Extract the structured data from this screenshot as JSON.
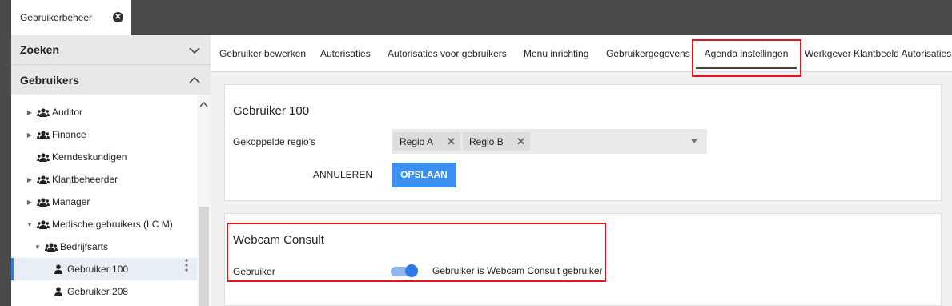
{
  "window": {
    "tab_title": "Gebruikerbeheer"
  },
  "sidebar": {
    "sections": [
      {
        "label": "Zoeken",
        "state": "collapsed"
      },
      {
        "label": "Gebruikers",
        "state": "expanded"
      }
    ],
    "tree": [
      {
        "label": "Auditor",
        "type": "group",
        "expandable": true
      },
      {
        "label": "Finance",
        "type": "group",
        "expandable": true
      },
      {
        "label": "Kerndeskundigen",
        "type": "group",
        "expandable": false
      },
      {
        "label": "Klantbeheerder",
        "type": "group",
        "expandable": true
      },
      {
        "label": "Manager",
        "type": "group",
        "expandable": true
      },
      {
        "label": "Medische gebruikers (LC M)",
        "type": "group",
        "expanded": true
      },
      {
        "label": "Bedrijfsarts",
        "type": "group",
        "expanded": true
      },
      {
        "label": "Gebruiker 100",
        "type": "user",
        "selected": true
      },
      {
        "label": "Gebruiker 208",
        "type": "user"
      }
    ]
  },
  "main": {
    "tabs": [
      {
        "label": "Gebruiker bewerken"
      },
      {
        "label": "Autorisaties"
      },
      {
        "label": "Autorisaties voor gebruikers"
      },
      {
        "label": "Menu inrichting"
      },
      {
        "label": "Gebruikergegevens"
      },
      {
        "label": "Agenda instellingen",
        "active": true
      },
      {
        "label": "Werkgever Klantbeeld Autorisaties"
      }
    ],
    "card1": {
      "title": "Gebruiker 100",
      "regions_label": "Gekoppelde regio's",
      "chips": [
        "Regio A",
        "Regio B"
      ],
      "cancel_label": "ANNULEREN",
      "save_label": "OPSLAAN"
    },
    "card2": {
      "title": "Webcam Consult",
      "field_label": "Gebruiker",
      "toggle_on": true,
      "toggle_label": "Gebruiker is Webcam Consult gebruiker"
    }
  },
  "colors": {
    "accent": "#3b8ff0",
    "highlight_box": "#e3141b",
    "topbar": "#4a4a4a"
  }
}
